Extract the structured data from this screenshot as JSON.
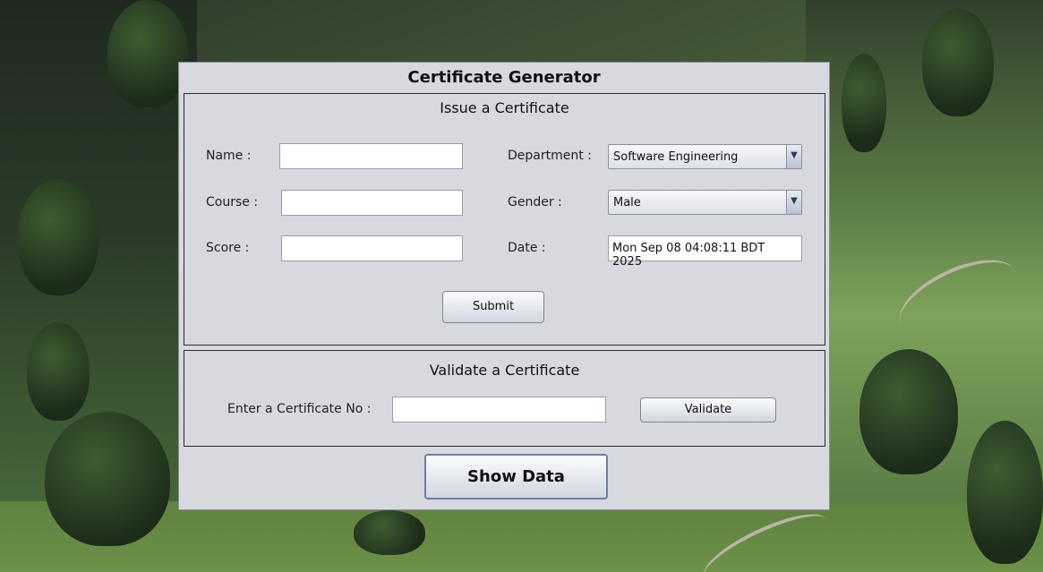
{
  "app": {
    "title": "Certificate Generator"
  },
  "issue": {
    "title": "Issue a Certificate",
    "name_label": "Name :",
    "name_value": "",
    "course_label": "Course :",
    "course_value": "",
    "score_label": "Score :",
    "score_value": "",
    "department_label": "Department :",
    "department_selected": "Software Engineering",
    "gender_label": "Gender :",
    "gender_selected": "Male",
    "date_label": "Date :",
    "date_value": "Mon Sep 08 04:08:11 BDT 2025",
    "submit_label": "Submit"
  },
  "validate": {
    "title": "Validate a Certificate",
    "cert_label": "Enter a Certificate No :",
    "cert_value": "",
    "validate_label": "Validate"
  },
  "footer": {
    "show_data_label": "Show Data"
  },
  "icons": {
    "dropdown_arrow": "▼"
  }
}
